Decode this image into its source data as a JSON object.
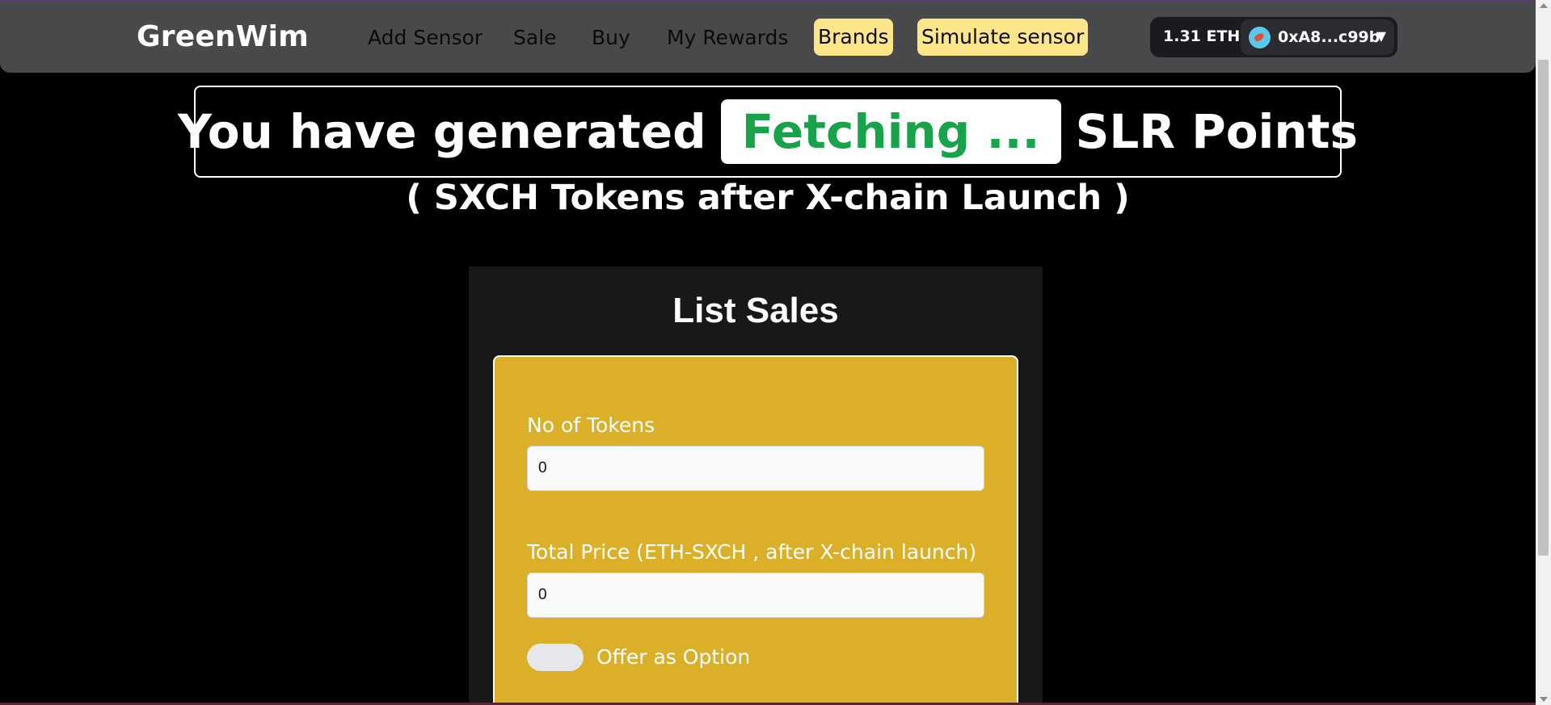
{
  "app": {
    "brand": "GreenWim"
  },
  "nav": {
    "links": [
      "Add Sensor",
      "Sale",
      "Buy",
      "My Rewards"
    ],
    "brands": "Brands",
    "simulate": "Simulate sensor"
  },
  "wallet": {
    "balance": "1.31 ETH",
    "address": "0xA8...c99b"
  },
  "banner": {
    "prefix": "You have generated",
    "points_value": "Fetching ...",
    "suffix": "SLR Points",
    "subtitle": "( SXCH Tokens after X-chain Launch )"
  },
  "colors": {
    "navbar": "#48494b",
    "pill": "#fde68a",
    "form_card": "#dbaf27",
    "fetch_text": "#16a34a"
  },
  "form": {
    "title": "List Sales",
    "tokens_label": "No of Tokens",
    "tokens_value": "0",
    "price_label": "Total Price (ETH-SXCH , after X-chain launch)",
    "price_value": "0",
    "option_label": "Offer as Option"
  }
}
